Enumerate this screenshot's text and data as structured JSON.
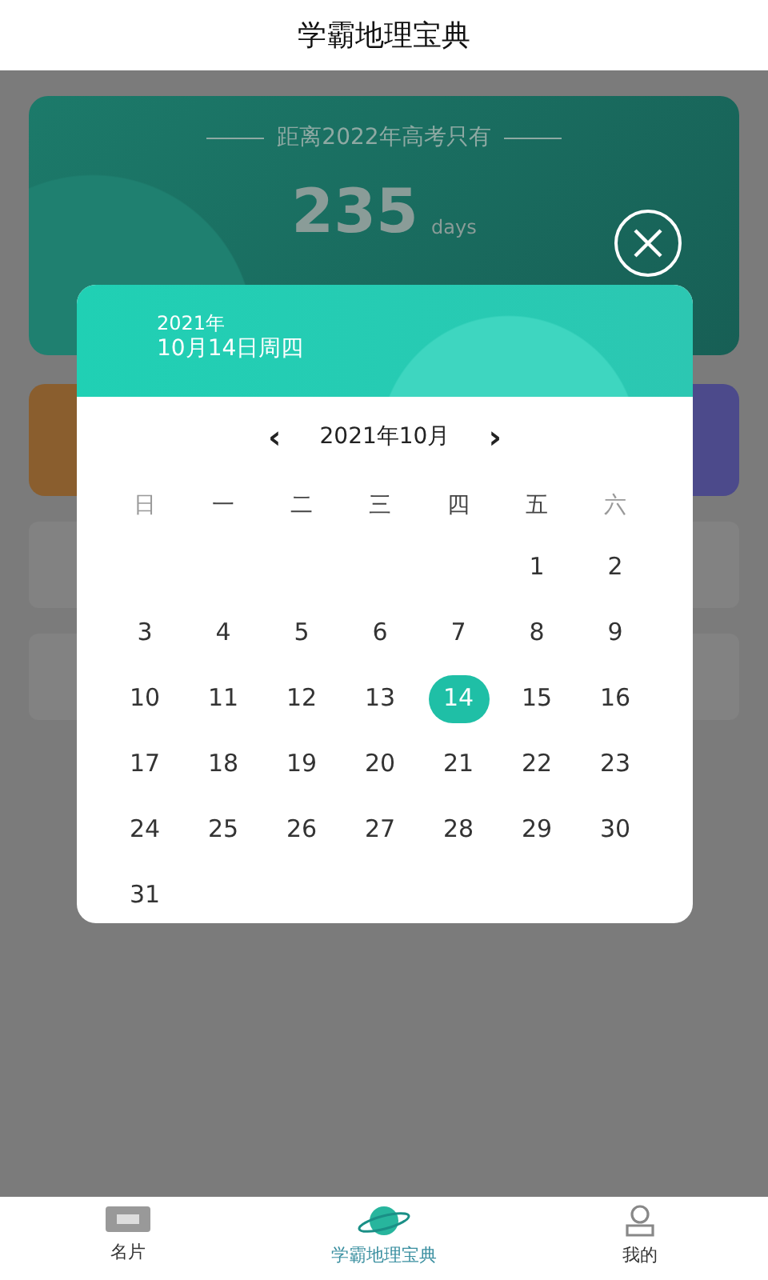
{
  "header": {
    "title": "学霸地理宝典"
  },
  "countdown": {
    "caption": "距离2022年高考只有",
    "number": "235",
    "unit": "days"
  },
  "calendar": {
    "year": "2021年",
    "date": "10月14日周四",
    "month": "2021年10月",
    "prev": "‹",
    "next": "›",
    "weekdays": [
      "日",
      "一",
      "二",
      "三",
      "四",
      "五",
      "六"
    ],
    "weeks": [
      {
        "kind": "first",
        "days": [
          {
            "day": "1",
            "selected": false
          },
          {
            "day": "2",
            "selected": false
          }
        ]
      },
      {
        "kind": "full",
        "days": [
          {
            "day": "3",
            "selected": false
          },
          {
            "day": "4",
            "selected": false
          },
          {
            "day": "5",
            "selected": false
          },
          {
            "day": "6",
            "selected": false
          },
          {
            "day": "7",
            "selected": false
          },
          {
            "day": "8",
            "selected": false
          },
          {
            "day": "9",
            "selected": false
          }
        ]
      },
      {
        "kind": "full",
        "days": [
          {
            "day": "10",
            "selected": false
          },
          {
            "day": "11",
            "selected": false
          },
          {
            "day": "12",
            "selected": false
          },
          {
            "day": "13",
            "selected": false
          },
          {
            "day": "14",
            "selected": true
          },
          {
            "day": "15",
            "selected": false
          },
          {
            "day": "16",
            "selected": false
          }
        ]
      },
      {
        "kind": "full",
        "days": [
          {
            "day": "17",
            "selected": false
          },
          {
            "day": "18",
            "selected": false
          },
          {
            "day": "19",
            "selected": false
          },
          {
            "day": "20",
            "selected": false
          },
          {
            "day": "21",
            "selected": false
          },
          {
            "day": "22",
            "selected": false
          },
          {
            "day": "23",
            "selected": false
          }
        ]
      },
      {
        "kind": "full",
        "days": [
          {
            "day": "24",
            "selected": false
          },
          {
            "day": "25",
            "selected": false
          },
          {
            "day": "26",
            "selected": false
          },
          {
            "day": "27",
            "selected": false
          },
          {
            "day": "28",
            "selected": false
          },
          {
            "day": "29",
            "selected": false
          },
          {
            "day": "30",
            "selected": false
          }
        ]
      },
      {
        "kind": "last",
        "days": [
          {
            "day": "31",
            "selected": false
          }
        ]
      }
    ]
  },
  "tabs": [
    {
      "label": "名片",
      "kind": "card",
      "selected": false
    },
    {
      "label": "学霸地理宝典",
      "kind": "planet",
      "selected": true
    },
    {
      "label": "我的",
      "kind": "user",
      "selected": false
    }
  ]
}
